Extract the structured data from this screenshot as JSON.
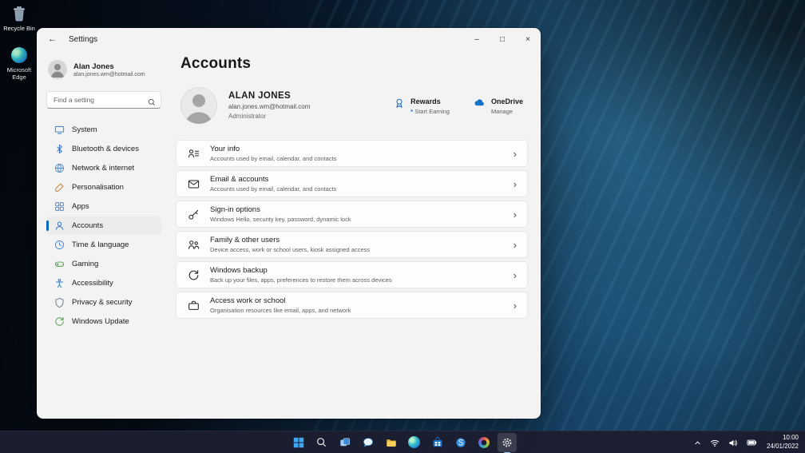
{
  "desktop": {
    "icons": [
      {
        "label": "Recycle Bin"
      },
      {
        "label": "Microsoft Edge"
      }
    ]
  },
  "window": {
    "titlebar": {
      "back": "←",
      "title": "Settings",
      "minimize": "–",
      "maximize": "□",
      "close": "×"
    },
    "sidebar": {
      "user": {
        "name": "Alan Jones",
        "email": "alan.jones.wm@hotmail.com"
      },
      "search": {
        "placeholder": "Find a setting"
      },
      "items": [
        {
          "label": "System"
        },
        {
          "label": "Bluetooth & devices"
        },
        {
          "label": "Network & internet"
        },
        {
          "label": "Personalisation"
        },
        {
          "label": "Apps"
        },
        {
          "label": "Accounts"
        },
        {
          "label": "Time & language"
        },
        {
          "label": "Gaming"
        },
        {
          "label": "Accessibility"
        },
        {
          "label": "Privacy & security"
        },
        {
          "label": "Windows Update"
        }
      ]
    },
    "main": {
      "title": "Accounts",
      "profile": {
        "name": "ALAN JONES",
        "email": "alan.jones.wm@hotmail.com",
        "role": "Administrator"
      },
      "rewards": {
        "title": "Rewards",
        "bullet": "*",
        "subtitle": "Start Earning"
      },
      "onedrive": {
        "title": "OneDrive",
        "subtitle": "Manage"
      },
      "chevron": "›",
      "cards": [
        {
          "title": "Your info",
          "subtitle": "Accounts used by email, calendar, and contacts"
        },
        {
          "title": "Email & accounts",
          "subtitle": "Accounts used by email, calendar, and contacts"
        },
        {
          "title": "Sign-in options",
          "subtitle": "Windows Hello, security key, password, dynamic lock"
        },
        {
          "title": "Family & other users",
          "subtitle": "Device access, work or school users, kiosk assigned access"
        },
        {
          "title": "Windows backup",
          "subtitle": "Back up your files, apps, preferences to restore them across devices"
        },
        {
          "title": "Access work or school",
          "subtitle": "Organisation resources like email, apps, and network"
        }
      ]
    }
  },
  "taskbar": {
    "clock": {
      "time": "10:00",
      "date": "24/01/2022"
    }
  }
}
